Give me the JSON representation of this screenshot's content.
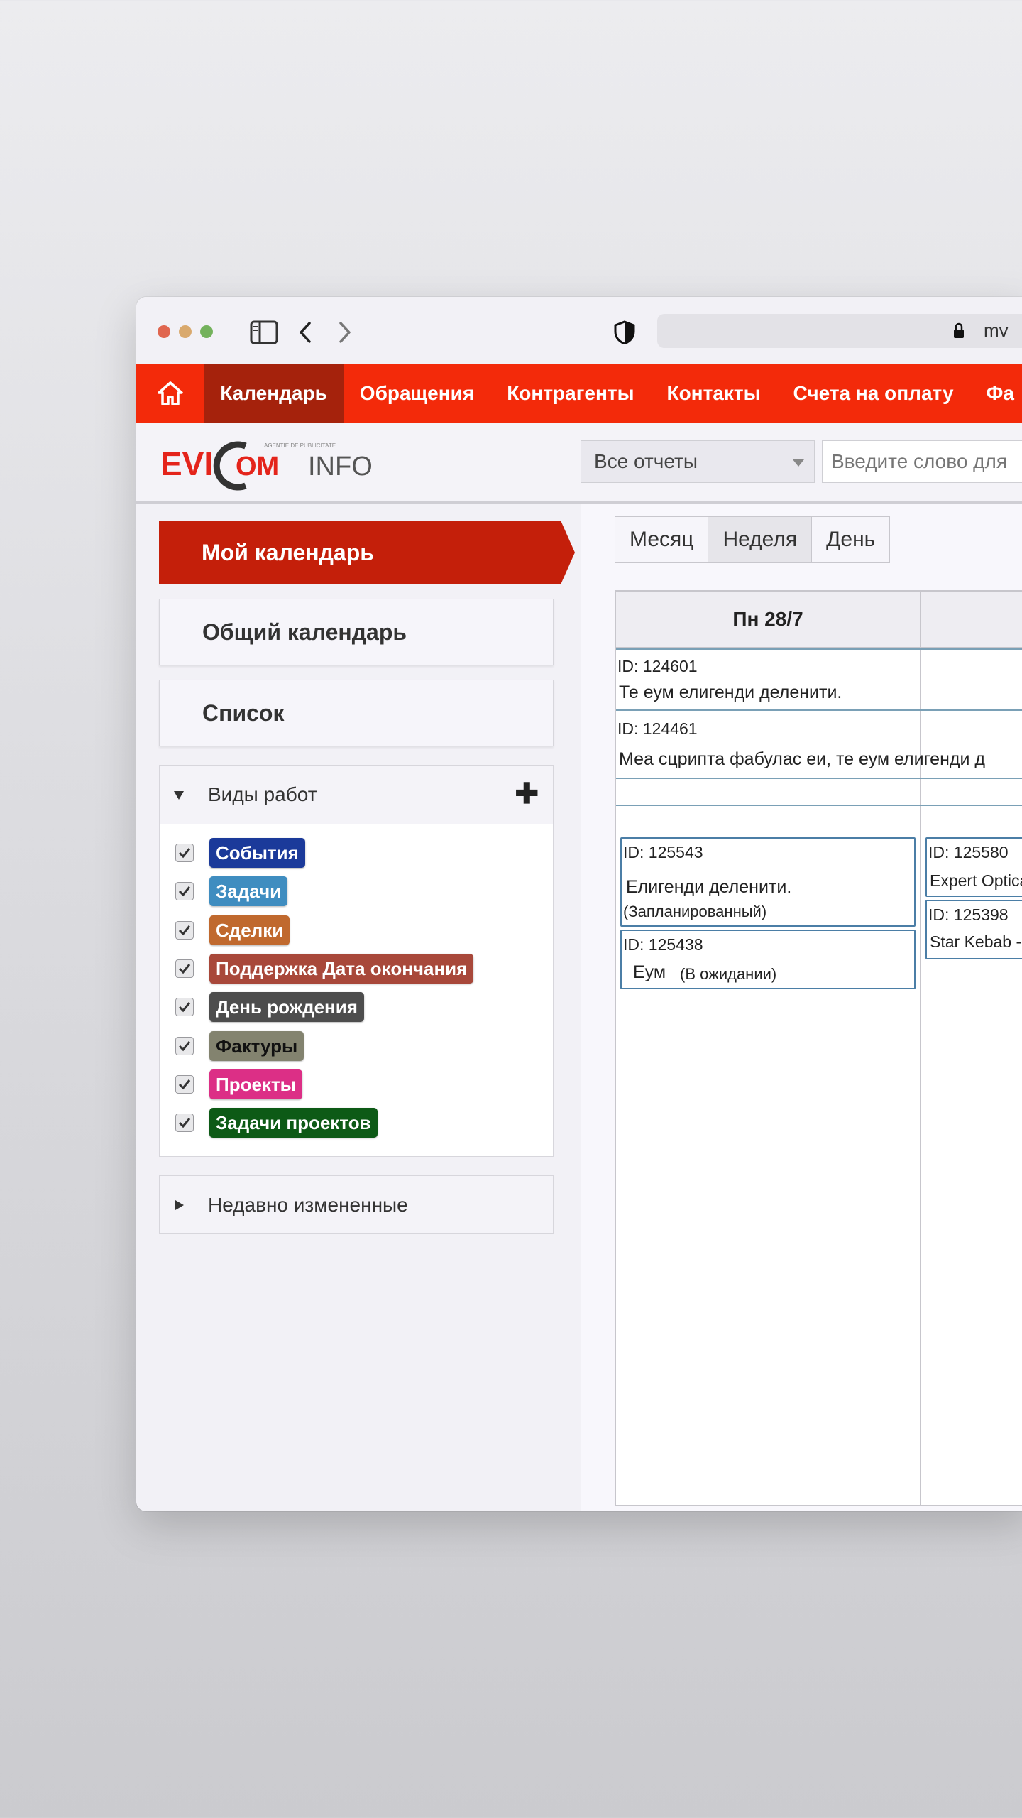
{
  "browser": {
    "url": "mv"
  },
  "nav": {
    "items": [
      {
        "label": "Календарь",
        "active": true
      },
      {
        "label": "Обращения"
      },
      {
        "label": "Контрагенты"
      },
      {
        "label": "Контакты"
      },
      {
        "label": "Счета на оплату"
      },
      {
        "label": "Фа"
      }
    ]
  },
  "header": {
    "logo_evi": "EVI",
    "logo_com": "OM",
    "logo_info": "INFO",
    "logo_tagline": "AGENTIE DE PUBLICITATE",
    "reports_select": "Все отчеты",
    "search_placeholder": "Введите слово для"
  },
  "sidebar": {
    "my_calendar": "Мой календарь",
    "shared_calendar": "Общий календарь",
    "list": "Список",
    "work_types_title": "Виды работ",
    "work_types": [
      {
        "label": "События",
        "color": "#1b3a9a",
        "text_color": "#ffffff"
      },
      {
        "label": "Задачи",
        "color": "#3f8dc0",
        "text_color": "#ffffff"
      },
      {
        "label": "Сделки",
        "color": "#c0692e",
        "text_color": "#ffffff"
      },
      {
        "label": "Поддержка Дата окончания",
        "color": "#a8483a",
        "text_color": "#ffffff"
      },
      {
        "label": "День рождения",
        "color": "#4d4d4d",
        "text_color": "#ffffff"
      },
      {
        "label": "Фактуры",
        "color": "#83836f",
        "text_color": "#111111"
      },
      {
        "label": "Проекты",
        "color": "#dc2f86",
        "text_color": "#ffffff"
      },
      {
        "label": "Задачи проектов",
        "color": "#0d5a16",
        "text_color": "#ffffff"
      }
    ],
    "recently_changed": "Недавно измененные"
  },
  "calendar": {
    "views": [
      "Месяц",
      "Неделя",
      "День"
    ],
    "active_view": "Неделя",
    "day_header": "Пн 28/7",
    "allday_events": [
      {
        "id": "ID: 124601",
        "title": "Те еум елигенди деленити."
      },
      {
        "id": "ID: 124461",
        "title": "Меа сцрипта фабулас еи, те еум елигенди д"
      }
    ],
    "events": [
      {
        "id": "ID: 125543",
        "title": "Елигенди деленити.",
        "status": "(Запланированный)"
      },
      {
        "id": "ID: 125438",
        "title": "Еум",
        "status": "(В ожидании)"
      },
      {
        "id": "ID: 125580",
        "title": "Expert Optica"
      },
      {
        "id": "ID: 125398",
        "title": "Star Kebab -"
      }
    ]
  }
}
